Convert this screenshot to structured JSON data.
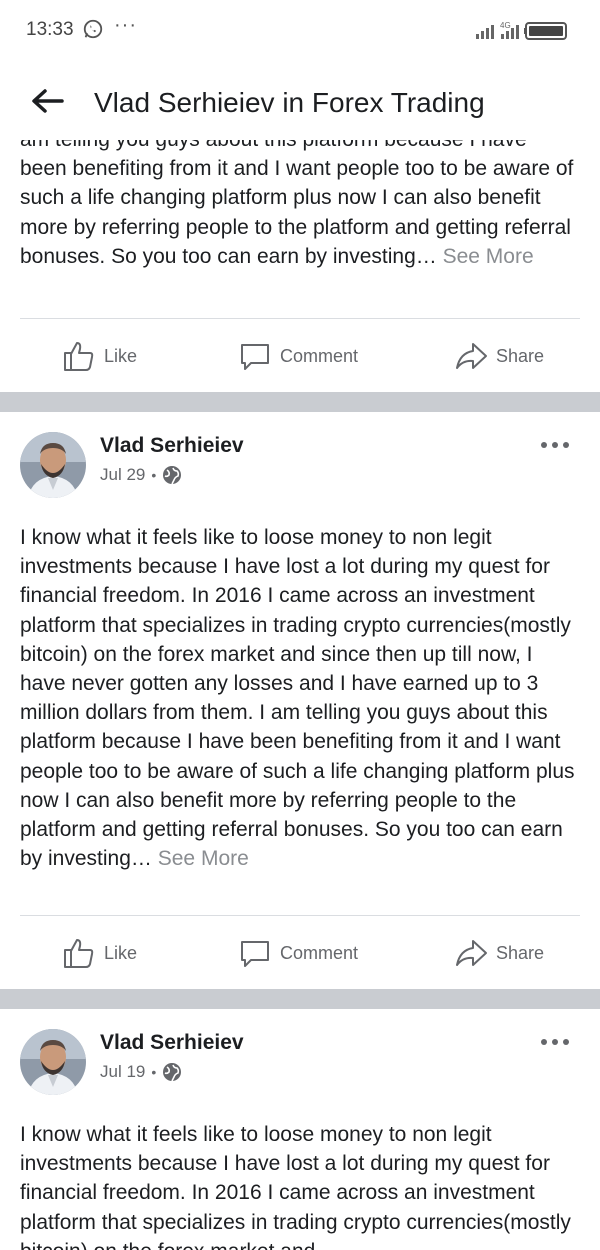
{
  "status_bar": {
    "time": "13:33",
    "network": "4G"
  },
  "header": {
    "title": "Vlad Serhieiev in Forex Trading"
  },
  "actions": {
    "like": "Like",
    "comment": "Comment",
    "share": "Share"
  },
  "see_more": "See More",
  "posts": [
    {
      "text": "am telling you guys about this platform because I have been benefiting from it and I want people too to be aware of such a life changing platform plus now I can also benefit more by referring people to the platform and getting referral bonuses. So you too can earn by investing…"
    },
    {
      "author": "Vlad Serhieiev",
      "date": "Jul 29",
      "text": "I know what it feels like to loose money to non legit investments because I have lost a lot during my quest for financial freedom. In 2016 I came across an investment platform that specializes in trading crypto currencies(mostly bitcoin) on the forex market and since then up till now, I have never gotten any losses and I have earned up to 3 million dollars from them. I am telling you guys about this platform because I have been benefiting from it and I want people too to be aware of such a life changing platform plus now I can also benefit more by referring people to the platform and getting referral bonuses. So you too can earn by investing…"
    },
    {
      "author": "Vlad Serhieiev",
      "date": "Jul 19",
      "text": "I know what it feels like to loose money to non legit investments because I have lost a lot during my quest for financial freedom. In 2016 I came across an investment platform that specializes in trading crypto currencies(mostly bitcoin) on the forex market and"
    }
  ]
}
